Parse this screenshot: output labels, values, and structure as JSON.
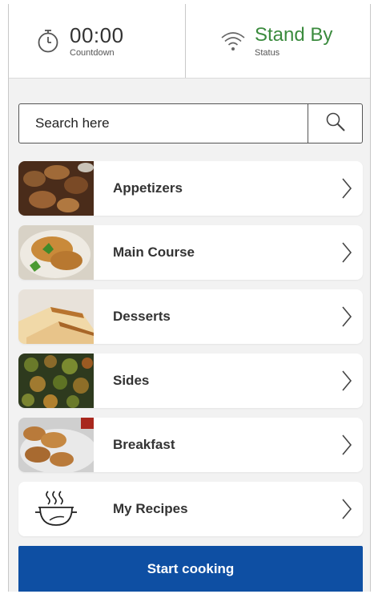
{
  "header": {
    "timer": {
      "value": "00:00",
      "label": "Countdown",
      "icon": "stopwatch-icon"
    },
    "status": {
      "value": "Stand By",
      "label": "Status",
      "icon": "wifi-icon",
      "color": "#3b8b3e"
    }
  },
  "search": {
    "placeholder": "Search here",
    "value": "",
    "icon": "search-icon"
  },
  "categories": [
    {
      "label": "Appetizers",
      "thumb": "appetizers-photo"
    },
    {
      "label": "Main Course",
      "thumb": "main-course-photo"
    },
    {
      "label": "Desserts",
      "thumb": "desserts-photo"
    },
    {
      "label": "Sides",
      "thumb": "sides-photo"
    },
    {
      "label": "Breakfast",
      "thumb": "breakfast-photo"
    },
    {
      "label": "My Recipes",
      "thumb": "cooking-pot-icon"
    }
  ],
  "start_button": {
    "label": "Start cooking",
    "color": "#0e4fa3"
  }
}
